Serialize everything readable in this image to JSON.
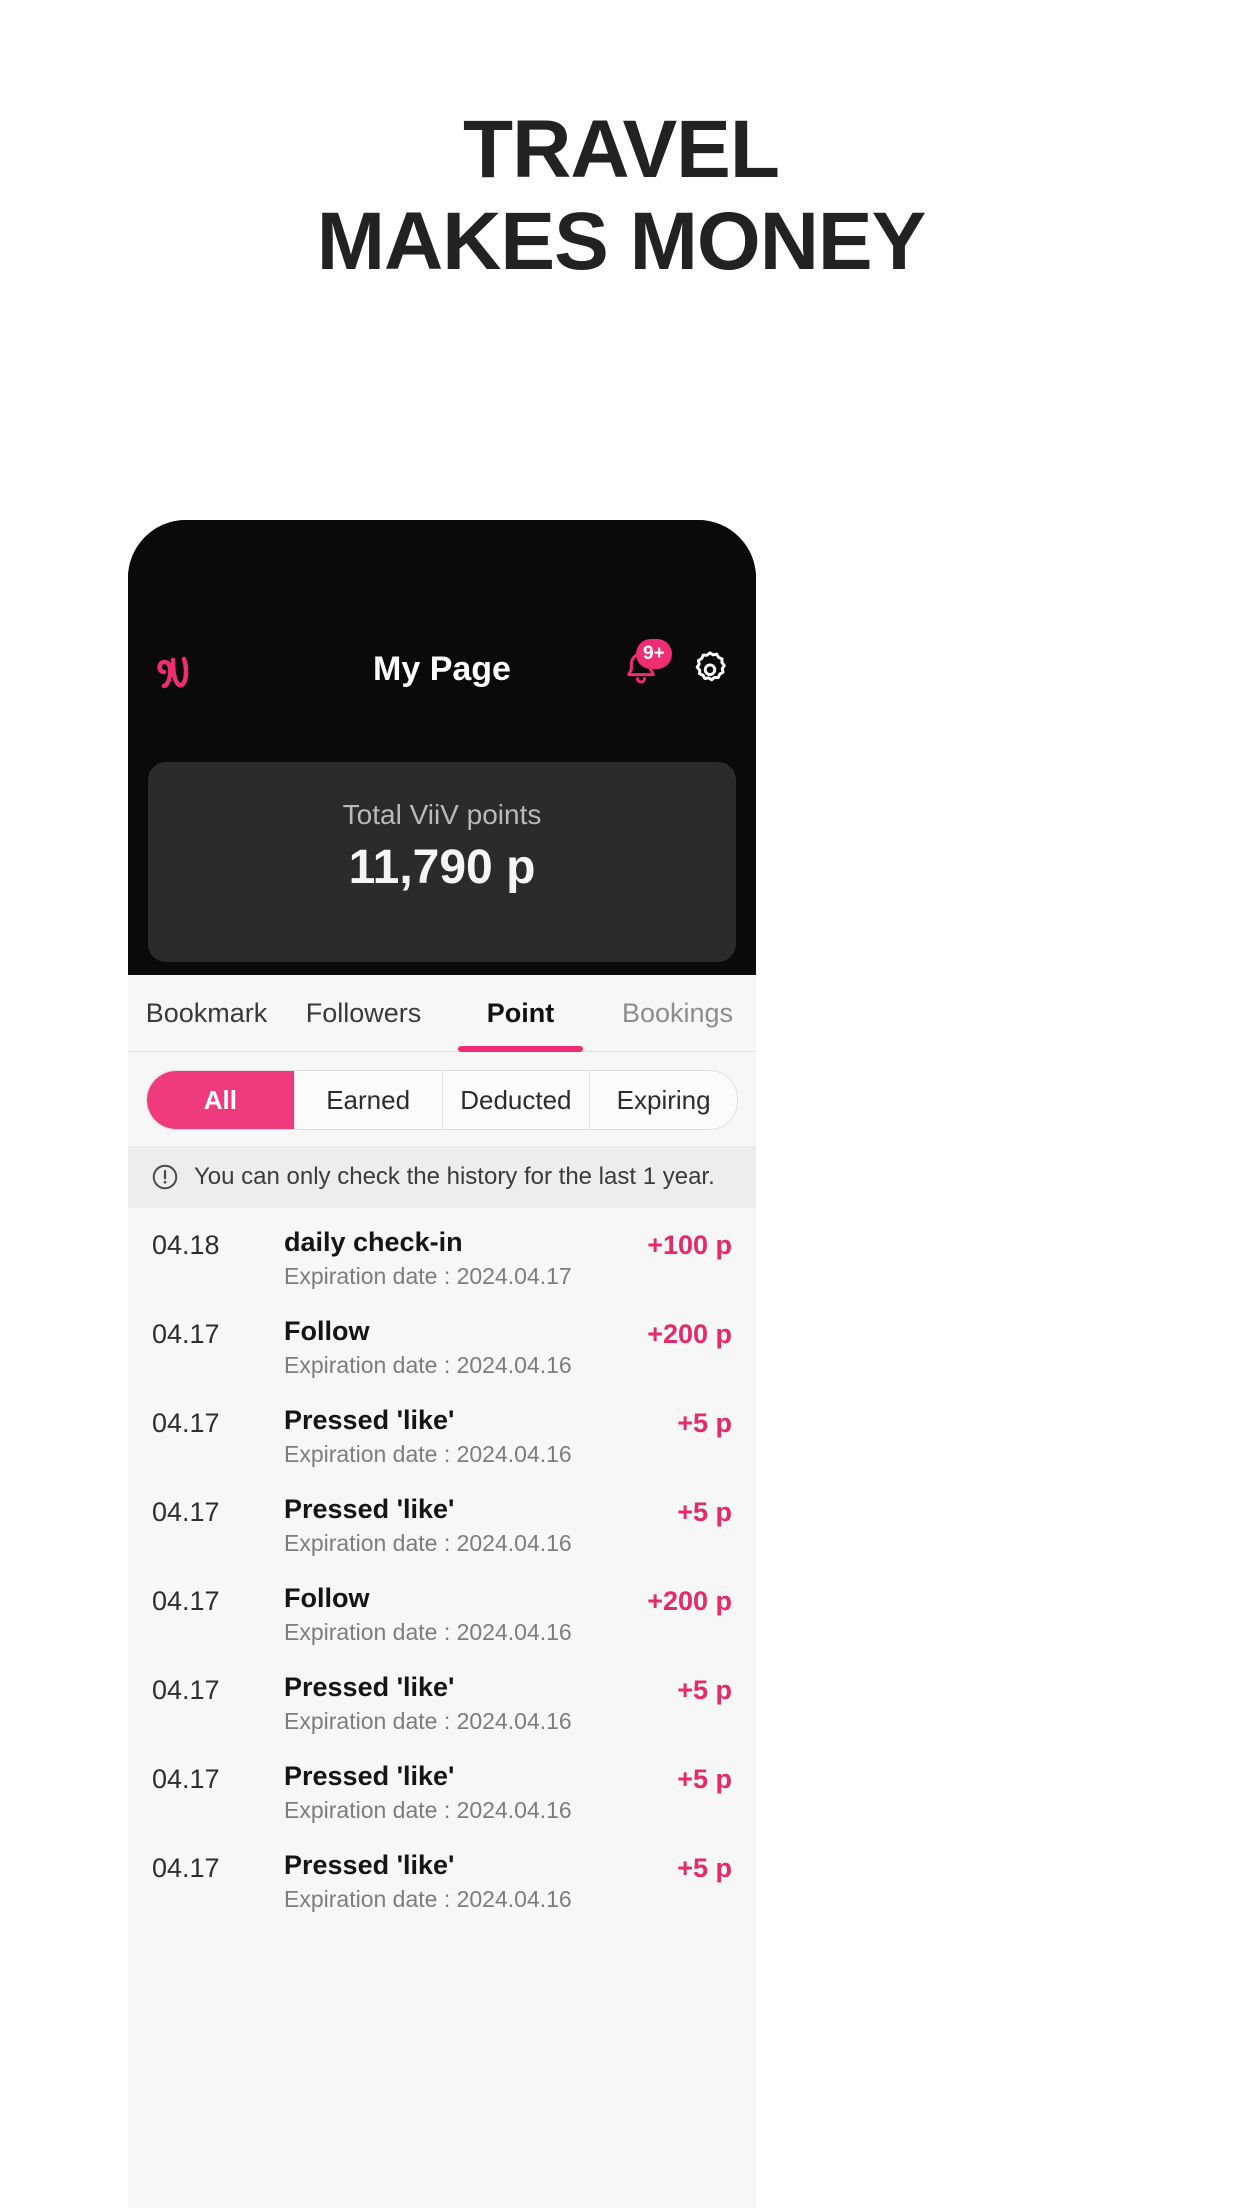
{
  "headline": {
    "line1": "TRAVEL",
    "line2": "MAKES MONEY"
  },
  "colors": {
    "accent_pink": "#ef2d72",
    "chip_pink": "#f03a7e",
    "amount_pink": "#e42a6b",
    "dark_bg": "#0a0a0a",
    "card_bg": "#2b2b2b",
    "app_bg": "#f7f7f7",
    "notice_bg": "#ededed"
  },
  "appbar": {
    "logo_icon": "viiv-logo-icon",
    "title": "My Page",
    "bell_icon": "bell-icon",
    "badge": "9+",
    "settings_icon": "gear-icon"
  },
  "points_card": {
    "label": "Total ViiV points",
    "value": "11,790 p"
  },
  "tabs": [
    {
      "label": "Bookmark",
      "state": "normal"
    },
    {
      "label": "Followers",
      "state": "normal"
    },
    {
      "label": "Point",
      "state": "active"
    },
    {
      "label": "Bookings",
      "state": "muted"
    }
  ],
  "filters": [
    {
      "label": "All",
      "state": "active"
    },
    {
      "label": "Earned",
      "state": "normal"
    },
    {
      "label": "Deducted",
      "state": "normal"
    },
    {
      "label": "Expiring",
      "state": "normal"
    }
  ],
  "notice": {
    "icon": "exclamation-circle-icon",
    "text": "You can only check the history for the last 1 year."
  },
  "history": [
    {
      "date": "04.18",
      "title": "daily check-in",
      "sub": "Expiration date : 2024.04.17",
      "amount": "+100 p"
    },
    {
      "date": "04.17",
      "title": "Follow",
      "sub": "Expiration date : 2024.04.16",
      "amount": "+200 p"
    },
    {
      "date": "04.17",
      "title": "Pressed 'like'",
      "sub": "Expiration date : 2024.04.16",
      "amount": "+5 p"
    },
    {
      "date": "04.17",
      "title": "Pressed 'like'",
      "sub": "Expiration date : 2024.04.16",
      "amount": "+5 p"
    },
    {
      "date": "04.17",
      "title": "Follow",
      "sub": "Expiration date : 2024.04.16",
      "amount": "+200 p"
    },
    {
      "date": "04.17",
      "title": "Pressed 'like'",
      "sub": "Expiration date : 2024.04.16",
      "amount": "+5 p"
    },
    {
      "date": "04.17",
      "title": "Pressed 'like'",
      "sub": "Expiration date : 2024.04.16",
      "amount": "+5 p"
    },
    {
      "date": "04.17",
      "title": "Pressed 'like'",
      "sub": "Expiration date : 2024.04.16",
      "amount": "+5 p"
    }
  ]
}
